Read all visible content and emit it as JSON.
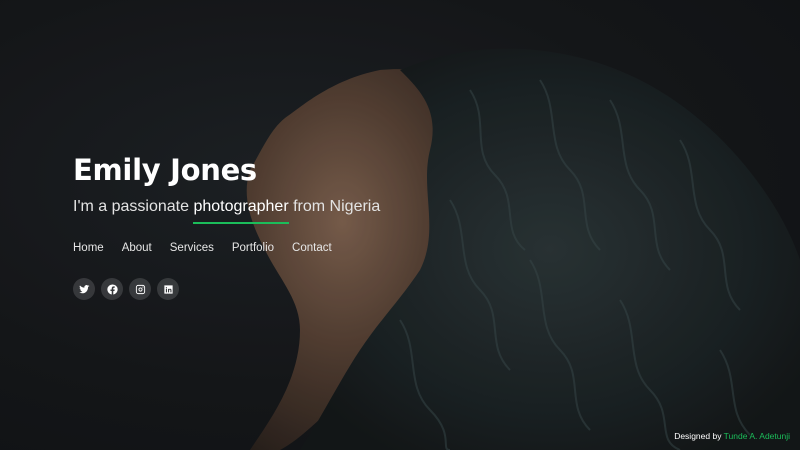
{
  "hero": {
    "name": "Emily Jones",
    "tagline_prefix": "I'm a passionate",
    "tagline_typed": "photographer",
    "tagline_suffix": "from Nigeria"
  },
  "nav": {
    "items": [
      {
        "label": "Home"
      },
      {
        "label": "About"
      },
      {
        "label": "Services"
      },
      {
        "label": "Portfolio"
      },
      {
        "label": "Contact"
      }
    ]
  },
  "social": {
    "items": [
      {
        "icon": "twitter-icon"
      },
      {
        "icon": "facebook-icon"
      },
      {
        "icon": "instagram-icon"
      },
      {
        "icon": "linkedin-icon"
      }
    ]
  },
  "footer": {
    "designed_by": "Designed by",
    "author": "Tunde A. Adetunji"
  },
  "colors": {
    "accent": "#1bbd5a",
    "background": "#16181b"
  }
}
